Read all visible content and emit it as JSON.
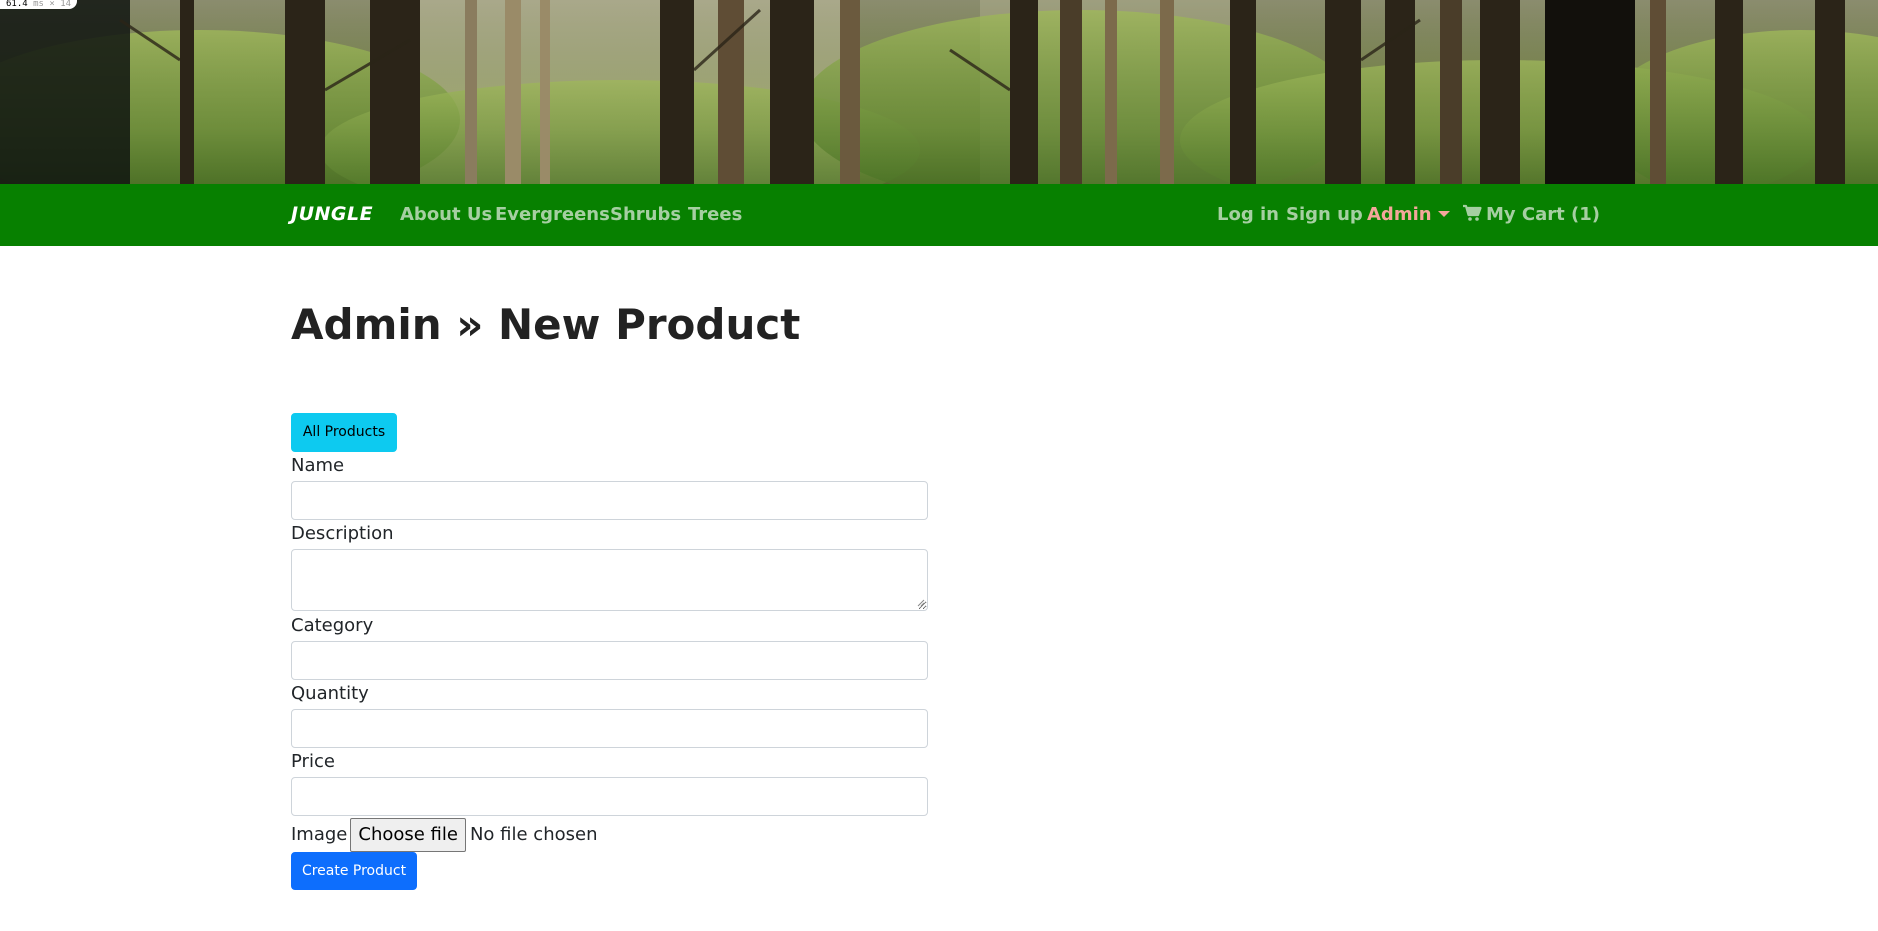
{
  "perf": {
    "value": "61.4",
    "unit": "ms",
    "extra": "× 14"
  },
  "nav": {
    "brand": "JUNGLE",
    "links": [
      "About Us",
      "Evergreens",
      "Shrubs",
      "Trees"
    ],
    "login": "Log in",
    "signup": "Sign up",
    "admin": "Admin",
    "cart": "My Cart (1)"
  },
  "colors": {
    "navbar": "#078000",
    "nav_link": "#a6cfa2",
    "admin_link": "#f4a79b",
    "info_button": "#0dcaf0",
    "primary_button": "#0d6efd"
  },
  "icons": {
    "cart": "shopping-cart-icon",
    "dropdown": "caret-down-icon"
  },
  "page": {
    "title": "Admin » New Product",
    "all_products_button": "All Products",
    "form": {
      "name_label": "Name",
      "name_value": "",
      "description_label": "Description",
      "description_value": "",
      "category_label": "Category",
      "category_value": "",
      "quantity_label": "Quantity",
      "quantity_value": "",
      "price_label": "Price",
      "price_value": "",
      "image_label": "Image",
      "file_button": "Choose file",
      "file_status": "No file chosen",
      "submit": "Create Product"
    }
  }
}
